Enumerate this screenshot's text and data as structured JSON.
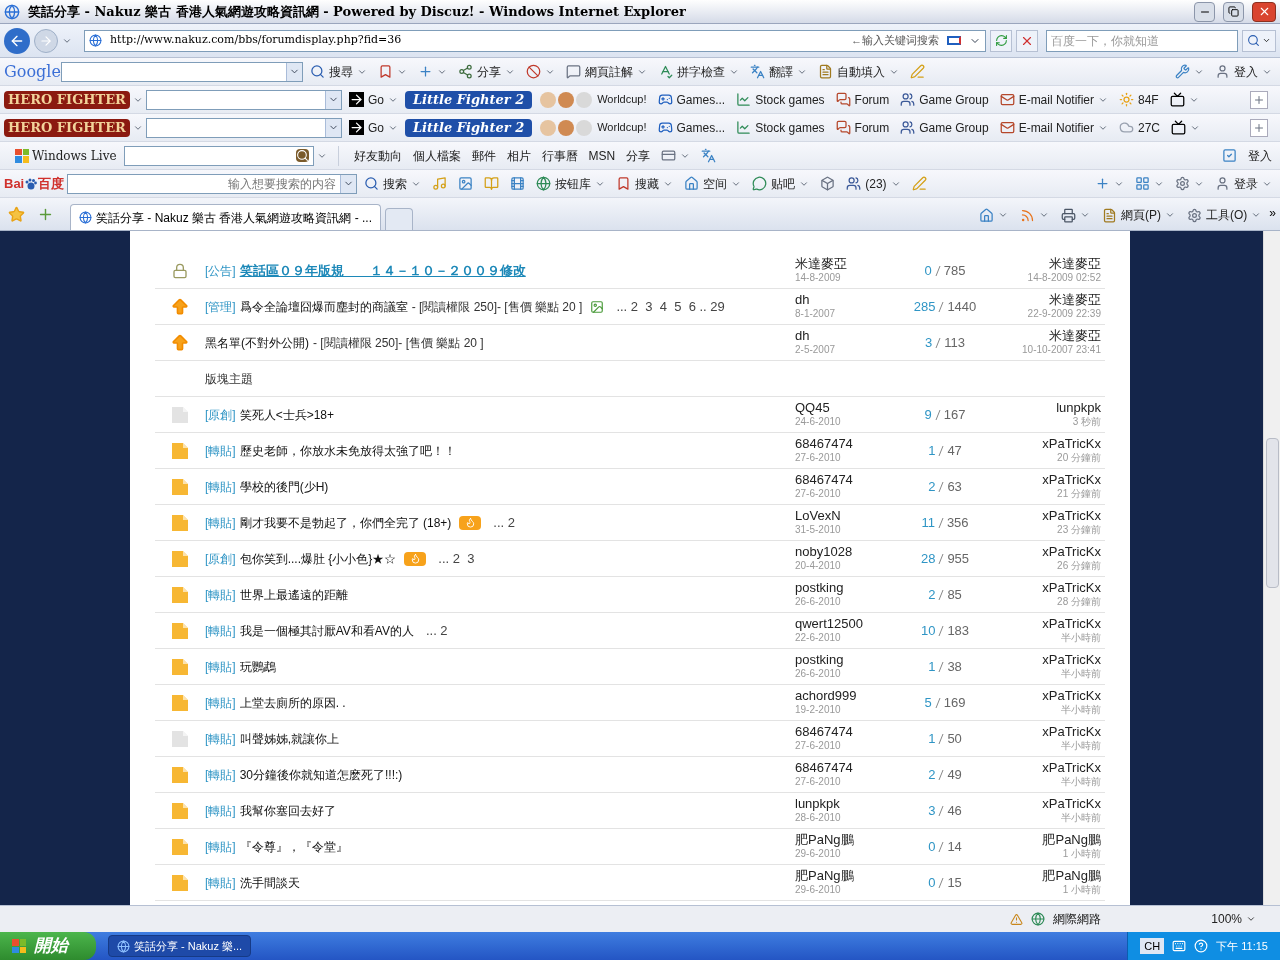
{
  "window": {
    "title": "笑話分享 - Nakuz 樂古 香港人氣網遊攻略資訊網 - Powered by Discuz! - Windows Internet Explorer"
  },
  "address_bar": {
    "url": "http://www.nakuz.com/bbs/forumdisplay.php?fid=36",
    "hint": "←输入关键词搜索",
    "search_placeholder": "百度一下，你就知道"
  },
  "google_bar": {
    "logo": "Google",
    "items": [
      {
        "kind": "search",
        "label": "搜尋",
        "menu": true
      },
      {
        "kind": "bookmark",
        "menu": true
      },
      {
        "kind": "plus",
        "menu": true
      },
      {
        "kind": "share",
        "label": "分享",
        "menu": true
      },
      {
        "kind": "block",
        "menu": true
      },
      {
        "kind": "note",
        "label": "網頁註解",
        "menu": true
      },
      {
        "kind": "spell",
        "label": "拼字檢查",
        "menu": true
      },
      {
        "kind": "translate",
        "label": "翻譯",
        "menu": true
      },
      {
        "kind": "fill",
        "label": "自動填入",
        "menu": true
      },
      {
        "kind": "pen"
      }
    ],
    "right": [
      {
        "kind": "wrench",
        "menu": true
      },
      {
        "kind": "user",
        "label": "登入",
        "menu": true
      }
    ]
  },
  "hero_bars": [
    {
      "logo": "HERO FIGHTER",
      "items": [
        {
          "kind": "go",
          "label": "Go",
          "menu": true
        },
        {
          "kind": "badge",
          "label": "Little Fighter 2"
        },
        {
          "kind": "avatars",
          "label": "Worldcup!"
        },
        {
          "kind": "game",
          "label": "Games..."
        },
        {
          "kind": "stock",
          "label": "Stock games"
        },
        {
          "kind": "forum",
          "label": "Forum"
        },
        {
          "kind": "group",
          "label": "Game Group"
        },
        {
          "kind": "mail",
          "label": "E-mail Notifier",
          "menu": true
        },
        {
          "kind": "sun",
          "label": "84F"
        },
        {
          "kind": "tv",
          "menu": true
        }
      ]
    },
    {
      "logo": "HERO FIGHTER",
      "items": [
        {
          "kind": "go",
          "label": "Go",
          "menu": true
        },
        {
          "kind": "badge",
          "label": "Little Fighter 2"
        },
        {
          "kind": "avatars",
          "label": "Worldcup!"
        },
        {
          "kind": "game",
          "label": "Games..."
        },
        {
          "kind": "stock",
          "label": "Stock games"
        },
        {
          "kind": "forum",
          "label": "Forum"
        },
        {
          "kind": "group",
          "label": "Game Group"
        },
        {
          "kind": "mail",
          "label": "E-mail Notifier",
          "menu": true
        },
        {
          "kind": "cloud",
          "label": "27C"
        },
        {
          "kind": "tv",
          "menu": true
        }
      ]
    }
  ],
  "live_bar": {
    "logo": "Windows Live",
    "items": [
      {
        "label": "好友動向"
      },
      {
        "label": "個人檔案"
      },
      {
        "label": "郵件"
      },
      {
        "label": "相片"
      },
      {
        "label": "行事曆"
      },
      {
        "label": "MSN"
      },
      {
        "label": "分享"
      },
      {
        "kind": "card",
        "menu": true
      },
      {
        "kind": "translate"
      }
    ],
    "right": [
      {
        "kind": "check"
      },
      {
        "label": "登入"
      }
    ]
  },
  "baidu_bar": {
    "logo_left": "Bai",
    "logo_right": "百度",
    "placeholder": "输入想要搜索的内容",
    "items": [
      {
        "kind": "search",
        "label": "搜索",
        "menu": true
      },
      {
        "kind": "music"
      },
      {
        "kind": "image"
      },
      {
        "kind": "book"
      },
      {
        "kind": "film"
      },
      {
        "kind": "globe",
        "label": "按钮库",
        "menu": true
      },
      {
        "kind": "bookmark",
        "label": "搜藏",
        "menu": true
      },
      {
        "kind": "home",
        "label": "空间",
        "menu": true
      },
      {
        "kind": "chat",
        "label": "贴吧",
        "menu": true
      },
      {
        "kind": "box"
      },
      {
        "kind": "group",
        "label": "(23)",
        "menu": true
      },
      {
        "kind": "pen"
      }
    ],
    "right": [
      {
        "kind": "plus",
        "menu": true
      },
      {
        "kind": "grid",
        "menu": true
      },
      {
        "kind": "gear",
        "menu": true
      },
      {
        "kind": "user",
        "label": "登录",
        "menu": true
      }
    ]
  },
  "tab_bar": {
    "tab": "笑話分享 - Nakuz 樂古 香港人氣網遊攻略資訊網 - ...",
    "commands": [
      {
        "kind": "home",
        "menu": true
      },
      {
        "kind": "rss",
        "menu": true
      },
      {
        "kind": "print",
        "menu": true
      },
      {
        "kind": "fill",
        "label": "網頁(P)",
        "menu": true
      },
      {
        "kind": "gear",
        "label": "工具(O)",
        "menu": true
      }
    ],
    "more": "»"
  },
  "forum": {
    "pinned": [
      {
        "kind": "lock",
        "prefix": "[公告]",
        "title": "笑話區０９年版規　　１４－１０－２００９修改",
        "emphasis": true,
        "author": "米達麥亞",
        "date": "14-8-2009",
        "replies": "0",
        "views": "785",
        "last_by": "米達麥亞",
        "last_time": "14-8-2009 02:52"
      },
      {
        "kind": "up",
        "prefix": "[管理]",
        "title": "爲令全論壇囧爆而塵封的商議室",
        "extra": " - [閱讀權限 250]- [售價 樂點 20 ]",
        "attachment": true,
        "pages": "... 2  3  4  5  6 .. 29",
        "author": "dh",
        "date": "8-1-2007",
        "replies": "285",
        "views": "1440",
        "last_by": "米達麥亞",
        "last_time": "22-9-2009 22:39"
      },
      {
        "kind": "up",
        "title": "黑名單(不對外公開)",
        "extra": " - [閱讀權限 250]- [售價 樂點 20 ]",
        "author": "dh",
        "date": "2-5-2007",
        "replies": "3",
        "views": "113",
        "last_by": "米達麥亞",
        "last_time": "10-10-2007 23:41"
      }
    ],
    "section": "版塊主題",
    "topics": [
      {
        "kind": "read",
        "prefix": "[原創]",
        "title": "笑死人<士兵>18+",
        "author": "QQ45",
        "date": "24-6-2010",
        "replies": "9",
        "views": "167",
        "last_by": "lunpkpk",
        "last_time": "3 秒前"
      },
      {
        "kind": "new",
        "prefix": "[轉貼]",
        "title": "歷史老師，你放水未免放得太強了吧！！",
        "author": "68467474",
        "date": "27-6-2010",
        "replies": "1",
        "views": "47",
        "last_by": "xPaTricKx",
        "last_time": "20 分鐘前"
      },
      {
        "kind": "new",
        "prefix": "[轉貼]",
        "title": "學校的後門(少H)",
        "author": "68467474",
        "date": "27-6-2010",
        "replies": "2",
        "views": "63",
        "last_by": "xPaTricKx",
        "last_time": "21 分鐘前"
      },
      {
        "kind": "new",
        "prefix": "[轉貼]",
        "title": "剛才我要不是勃起了，你們全完了 (18+)",
        "hot": true,
        "pages": "... 2",
        "author": "LoVexN",
        "date": "31-5-2010",
        "replies": "11",
        "views": "356",
        "last_by": "xPaTricKx",
        "last_time": "23 分鐘前"
      },
      {
        "kind": "new",
        "prefix": "[原創]",
        "title": "包你笑到....爆肚 {小小色}★☆",
        "hot": true,
        "pages": "... 2  3",
        "author": "noby1028",
        "date": "20-4-2010",
        "replies": "28",
        "views": "955",
        "last_by": "xPaTricKx",
        "last_time": "26 分鐘前"
      },
      {
        "kind": "new",
        "prefix": "[轉貼]",
        "title": "世界上最遙遠的距離",
        "author": "postking",
        "date": "26-6-2010",
        "replies": "2",
        "views": "85",
        "last_by": "xPaTricKx",
        "last_time": "28 分鐘前"
      },
      {
        "kind": "new",
        "prefix": "[轉貼]",
        "title": "我是一個極其討厭AV和看AV的人",
        "pages": "... 2",
        "author": "qwert12500",
        "date": "22-6-2010",
        "replies": "10",
        "views": "183",
        "last_by": "xPaTricKx",
        "last_time": "半小時前"
      },
      {
        "kind": "new",
        "prefix": "[轉貼]",
        "title": "玩鸚鵡",
        "author": "postking",
        "date": "26-6-2010",
        "replies": "1",
        "views": "38",
        "last_by": "xPaTricKx",
        "last_time": "半小時前"
      },
      {
        "kind": "new",
        "prefix": "[轉貼]",
        "title": "上堂去廁所的原因. .",
        "author": "achord999",
        "date": "19-2-2010",
        "replies": "5",
        "views": "169",
        "last_by": "xPaTricKx",
        "last_time": "半小時前"
      },
      {
        "kind": "read",
        "prefix": "[轉貼]",
        "title": "叫聲姊姊,就讓你上",
        "author": "68467474",
        "date": "27-6-2010",
        "replies": "1",
        "views": "50",
        "last_by": "xPaTricKx",
        "last_time": "半小時前"
      },
      {
        "kind": "new",
        "prefix": "[轉貼]",
        "title": "30分鐘後你就知道怎麽死了!!!:)",
        "author": "68467474",
        "date": "27-6-2010",
        "replies": "2",
        "views": "49",
        "last_by": "xPaTricKx",
        "last_time": "半小時前"
      },
      {
        "kind": "new",
        "prefix": "[轉貼]",
        "title": "我幫你塞回去好了",
        "author": "lunpkpk",
        "date": "28-6-2010",
        "replies": "3",
        "views": "46",
        "last_by": "xPaTricKx",
        "last_time": "半小時前"
      },
      {
        "kind": "new",
        "prefix": "[轉貼]",
        "title": "『令尊』，『令堂』",
        "author": "肥PaNg鵬",
        "date": "29-6-2010",
        "replies": "0",
        "views": "14",
        "last_by": "肥PaNg鵬",
        "last_time": "1 小時前"
      },
      {
        "kind": "new",
        "prefix": "[轉貼]",
        "title": "洗手間談天",
        "author": "肥PaNg鵬",
        "date": "29-6-2010",
        "replies": "0",
        "views": "15",
        "last_by": "肥PaNg鵬",
        "last_time": "1 小時前"
      }
    ]
  },
  "status_bar": {
    "zone": "網際網路",
    "zoom": "100%"
  },
  "taskbar": {
    "start": "開始",
    "task": "笑話分享 - Nakuz 樂...",
    "lang": "CH",
    "clock": "下午 11:15"
  }
}
